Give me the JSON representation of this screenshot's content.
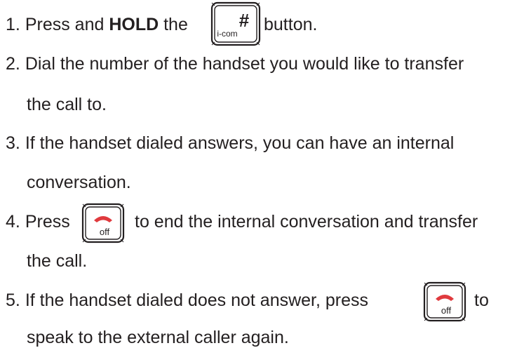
{
  "steps": [
    {
      "number": "1.",
      "parts": {
        "a": "Press and ",
        "bold": "HOLD",
        "b": " the",
        "c": " button."
      }
    },
    {
      "number": "2.",
      "line1": "Dial the number of the handset you would like to transfer",
      "line2": "the call to."
    },
    {
      "number": "3.",
      "line1": "If the handset dialed answers, you can have an internal",
      "line2": "conversation."
    },
    {
      "number": "4.",
      "line1a": "Press",
      "line1b": "to end the internal conversation and transfer",
      "line2": "the call."
    },
    {
      "number": "5.",
      "line1a": "If the handset dialed does not answer, press",
      "line1b": "to",
      "line2": "speak to the external caller again."
    }
  ],
  "keys": {
    "icom": {
      "symbol": "#",
      "label": "i-com",
      "icon": "icom-hash-key-icon"
    },
    "off": {
      "label": "off",
      "icon": "off-hangup-key-icon",
      "handset_color": "#e03a3e"
    }
  }
}
